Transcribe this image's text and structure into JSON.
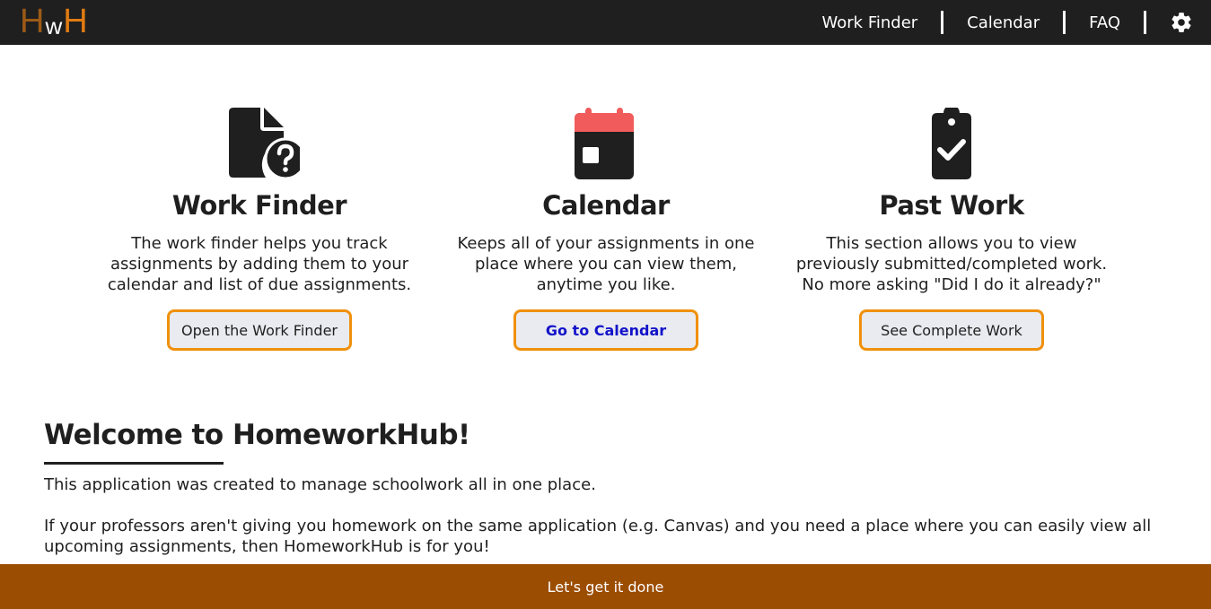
{
  "header": {
    "logo": {
      "first": "H",
      "middle": "w",
      "last": "H"
    },
    "nav": [
      {
        "label": "Work Finder"
      },
      {
        "label": "Calendar"
      },
      {
        "label": "FAQ"
      }
    ],
    "settings_icon": "gear-icon"
  },
  "cards": [
    {
      "icon": "file-question-icon",
      "title": "Work Finder",
      "description": "The work finder helps you track assignments by adding them to your calendar and list of due assignments.",
      "button": "Open the Work Finder"
    },
    {
      "icon": "calendar-icon",
      "title": "Calendar",
      "description": "Keeps all of your assignments in one place where you can view them, anytime you like.",
      "button": "Go to Calendar"
    },
    {
      "icon": "clipboard-check-icon",
      "title": "Past Work",
      "description": "This section allows you to view previously submitted/completed work. No more asking \"Did I do it already?\"",
      "button": "See Complete Work"
    }
  ],
  "welcome": {
    "title": "Welcome to HomeworkHub!",
    "paragraph1": "This application was created to manage schoolwork all in one place.",
    "paragraph2": "If your professors aren't giving you homework on the same application (e.g. Canvas) and you need a place where you can easily view all upcoming assignments, then HomeworkHub is for you!"
  },
  "footer": {
    "text": "Let's get it done"
  },
  "colors": {
    "header_bg": "#1f1f1f",
    "accent_orange": "#f0900c",
    "footer_bg": "#9b4d02",
    "calendar_red": "#f15b5b",
    "link_blue": "#1313c9"
  }
}
